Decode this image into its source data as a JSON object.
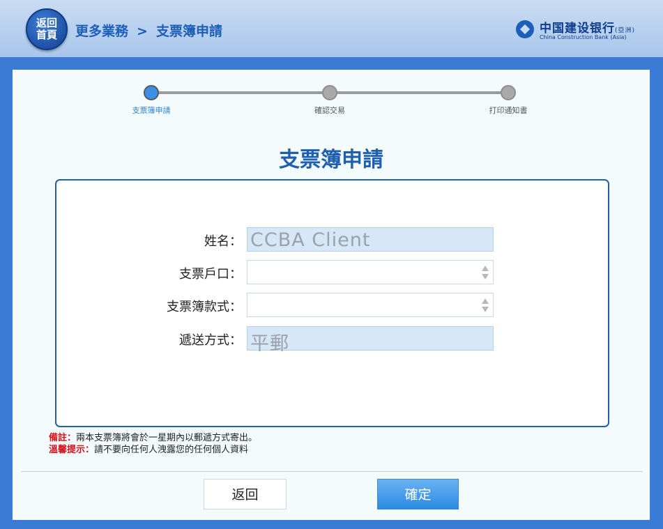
{
  "header": {
    "home_line1": "返回",
    "home_line2": "首頁",
    "breadcrumb_parent": "更多業務",
    "breadcrumb_separator": ">",
    "breadcrumb_current": "支票簿申請",
    "logo_cn": "中国建设银行",
    "logo_cn_suffix": "(亞洲)",
    "logo_en": "China Construction Bank (Asia)"
  },
  "steps": [
    {
      "label": "支票簿申請",
      "active": true
    },
    {
      "label": "確認交易",
      "active": false
    },
    {
      "label": "打印通知書",
      "active": false
    }
  ],
  "page_title": "支票簿申請",
  "form": {
    "name_label": "姓名：",
    "name_value": "CCBA Client",
    "account_label": "支票戶口：",
    "account_value": "",
    "style_label": "支票簿款式：",
    "style_value": "",
    "delivery_label": "遞送方式：",
    "delivery_value": "平郵"
  },
  "notes": {
    "remark_label": "備註：",
    "remark_text": "兩本支票簿將會於一星期內以郵遞方式寄出。",
    "tip_label": "溫馨提示：",
    "tip_text": "請不要向任何人洩露您的任何個人資料"
  },
  "buttons": {
    "back": "返回",
    "confirm": "確定"
  },
  "colors": {
    "accent": "#1f5fb0",
    "active_step": "#3b90e6",
    "warning": "#d4141b",
    "readonly_field": "#d6e7f8"
  }
}
